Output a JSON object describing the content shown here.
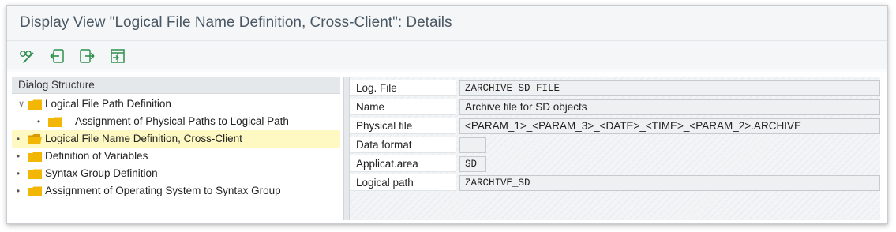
{
  "window": {
    "title": "Display View \"Logical File Name Definition, Cross-Client\": Details"
  },
  "toolbar": {
    "buttons": [
      {
        "icon": "display-change-icon"
      },
      {
        "icon": "previous-entry-icon"
      },
      {
        "icon": "next-entry-icon"
      },
      {
        "icon": "variable-list-icon"
      }
    ]
  },
  "tree": {
    "header": "Dialog Structure",
    "items": [
      {
        "label": "Logical File Path Definition",
        "expanded": true
      },
      {
        "label": "Assignment of Physical Paths to Logical Path"
      },
      {
        "label": "Logical File Name Definition, Cross-Client",
        "selected": true
      },
      {
        "label": "Definition of Variables"
      },
      {
        "label": "Syntax Group Definition"
      },
      {
        "label": "Assignment of Operating System to Syntax Group"
      }
    ]
  },
  "details": {
    "fields": [
      {
        "label": "Log. File",
        "value": "ZARCHIVE_SD_FILE"
      },
      {
        "label": "Name",
        "value": "Archive file for SD objects"
      },
      {
        "label": "Physical file",
        "value": "<PARAM_1>_<PARAM_3>_<DATE>_<TIME>_<PARAM_2>.ARCHIVE"
      },
      {
        "label": "Data format",
        "value": ""
      },
      {
        "label": "Applicat.area",
        "value": "SD"
      },
      {
        "label": "Logical path",
        "value": "ZARCHIVE_SD"
      }
    ]
  },
  "colors": {
    "folder": "#f2b705",
    "selected_row": "#fef9c3",
    "focus_marker": "#d9302c",
    "toolbar_icon": "#2f8f4e"
  }
}
